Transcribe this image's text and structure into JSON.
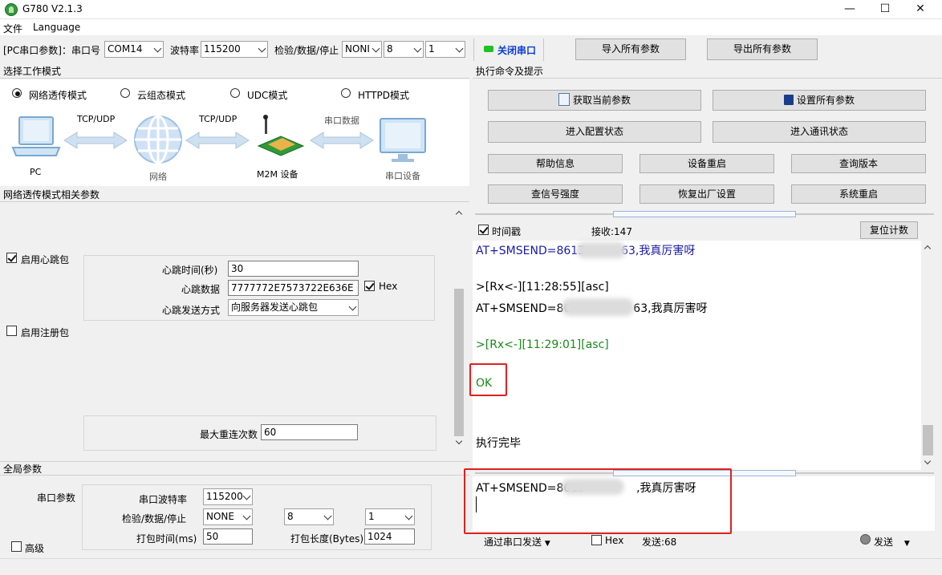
{
  "window": {
    "title": "G780 V2.1.3",
    "min": "—",
    "max": "☐",
    "close": "✕"
  },
  "menu": [
    "文件",
    "Language"
  ],
  "toolbar": {
    "port_label": "[PC串口参数]：串口号",
    "port_value": "COM14",
    "baud_label": "波特率",
    "baud_value": "115200",
    "parity_label": "检验/数据/停止",
    "parity_value": "NONI",
    "databits_value": "8",
    "stopbits_value": "1",
    "close_port_label": "关闭串口",
    "import_label": "导入所有参数",
    "export_label": "导出所有参数",
    "status_color": "#22c022"
  },
  "mode": {
    "header": "选择工作模式",
    "options": [
      "网络透传模式",
      "云组态模式",
      "UDC模式",
      "HTTPD模式"
    ],
    "selected": 0,
    "diagram": {
      "pc": "PC",
      "link1": "TCP/UDP",
      "net": "网络",
      "link2": "TCP/UDP",
      "m2m": "M2M 设备",
      "link3": "串口数据",
      "serial": "串口设备"
    }
  },
  "net_params": {
    "header": "网络透传模式相关参数",
    "heartbeat_label": "启用心跳包",
    "heartbeat_checked": true,
    "heartbeat_time_label": "心跳时间(秒)",
    "heartbeat_time": "30",
    "heartbeat_data_label": "心跳数据",
    "heartbeat_data": "7777772E7573722E636E",
    "hex_label": "Hex",
    "hex_checked": true,
    "send_mode_label": "心跳发送方式",
    "send_mode": "向服务器发送心跳包",
    "register_label": "启用注册包",
    "register_checked": false,
    "retry_label": "最大重连次数",
    "retry": "60"
  },
  "global": {
    "header": "全局参数",
    "serial_label": "串口参数",
    "baud_label": "串口波特率",
    "baud": "115200",
    "parity_label": "检验/数据/停止",
    "parity": "NONE",
    "databits": "8",
    "stopbits": "1",
    "pack_time_label": "打包时间(ms)",
    "pack_time": "50",
    "pack_len_label": "打包长度(Bytes)",
    "pack_len": "1024",
    "advanced_label": "高级"
  },
  "commands": {
    "header": "执行命令及提示",
    "get_params": "获取当前参数",
    "set_params": "设置所有参数",
    "enter_config": "进入配置状态",
    "enter_comm": "进入通讯状态",
    "help": "帮助信息",
    "reboot_device": "设备重启",
    "query_version": "查询版本",
    "signal": "查信号强度",
    "factory": "恢复出厂设置",
    "system_reboot": "系统重启"
  },
  "log": {
    "timestamp_label": "时间戳",
    "timestamp_checked": true,
    "recv_label": "接收:147",
    "reset_label": "复位计数",
    "lines": [
      {
        "text": "AT+SMSEND=8613",
        "tail": "63,我真厉害呀",
        "color": "#1a1aa6"
      },
      {
        "text": ">[Rx<-][11:28:55][asc]",
        "tail": "",
        "color": "#000000"
      },
      {
        "text": "AT+SMSEND=86",
        "tail": "63,我真厉害呀",
        "color": "#000000"
      },
      {
        "text": ">[Rx<-][11:29:01][asc]",
        "tail": "",
        "color": "#1a8a1a"
      },
      {
        "text": "OK",
        "tail": "",
        "color": "#1a8a1a"
      },
      {
        "text": "执行完毕",
        "tail": "",
        "color": "#000000"
      }
    ]
  },
  "send": {
    "text_head": "AT+SMSEND=8613",
    "text_tail": ",我真厉害呀",
    "via_label": "通过串口发送",
    "hex_label": "Hex",
    "sent_label": "发送:68",
    "send_label": "发送"
  }
}
